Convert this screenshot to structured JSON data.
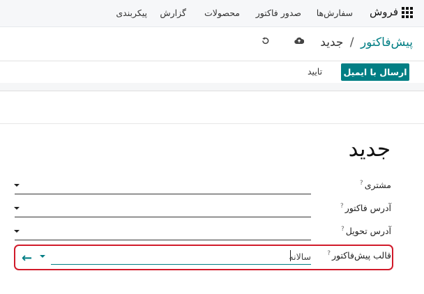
{
  "topbar": {
    "app_name": "فروش",
    "menu": [
      "سفارش‌ها",
      "صدور فاکتور",
      "محصولات",
      "گزارش",
      "پیکربندی"
    ],
    "apps_icon": "grid-icon"
  },
  "control_panel": {
    "breadcrumb_parent": "پیش‌فاکتور",
    "breadcrumb_separator": "/",
    "breadcrumb_current": "جدید",
    "save_icon": "cloud-upload-icon",
    "discard_icon": "undo-icon"
  },
  "statusbar": {
    "send_email_label": "ارسال با ایمیل",
    "confirm_label": "تایید"
  },
  "form": {
    "title": "جدید",
    "fields": [
      {
        "label": "مشتری",
        "help": "?"
      },
      {
        "label": "آدرس فاکتور",
        "help": "?"
      },
      {
        "label": "آدرس تحویل",
        "help": "?"
      },
      {
        "label": "قالب پیش‌فاکتور",
        "help": "?",
        "value": "سالانه"
      }
    ]
  },
  "colors": {
    "accent": "#017e84",
    "highlight": "#d11a2a"
  }
}
